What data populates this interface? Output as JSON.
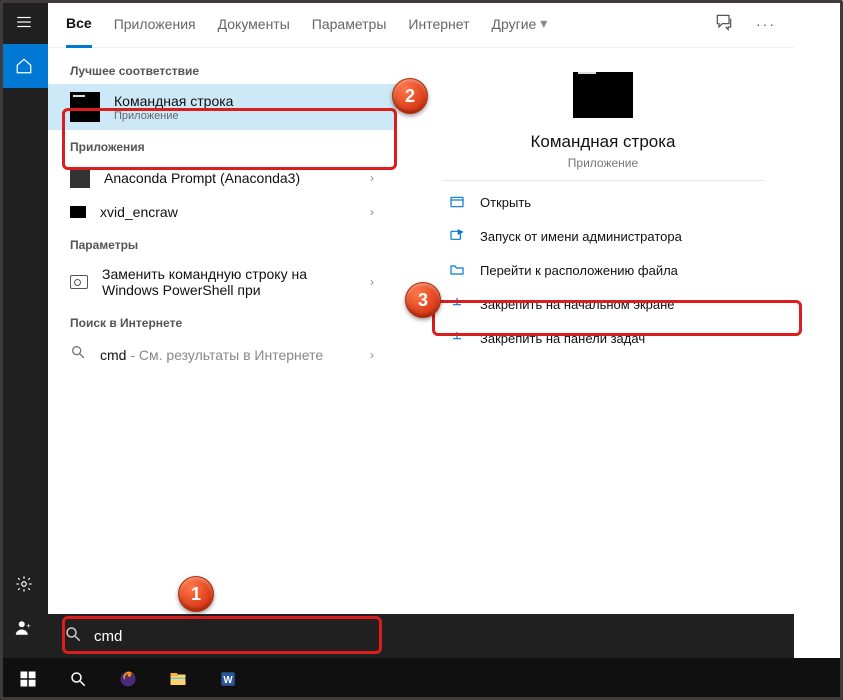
{
  "tabs": {
    "all": "Все",
    "apps": "Приложения",
    "docs": "Документы",
    "settings": "Параметры",
    "web": "Интернет",
    "more": "Другие",
    "more_caret": "▾"
  },
  "sections": {
    "best_match": "Лучшее соответствие",
    "apps": "Приложения",
    "settings": "Параметры",
    "web": "Поиск в Интернете"
  },
  "best": {
    "title": "Командная строка",
    "subtitle": "Приложение"
  },
  "app_results": {
    "r1": "Anaconda Prompt (Anaconda3)",
    "r2": "xvid_encraw"
  },
  "settings_results": {
    "r1_l1": "Заменить командную строку на",
    "r1_l2": "Windows PowerShell при"
  },
  "web_results": {
    "prefix": "cmd",
    "suffix": " - См. результаты в Интернете"
  },
  "preview": {
    "title": "Командная строка",
    "subtitle": "Приложение"
  },
  "actions": {
    "open": "Открыть",
    "admin": "Запуск от имени администратора",
    "location": "Перейти к расположению файла",
    "pin_start": "Закрепить на начальном экране",
    "pin_task": "Закрепить на панели задач"
  },
  "search": {
    "value": "cmd"
  },
  "badges": {
    "b1": "1",
    "b2": "2",
    "b3": "3"
  },
  "chevron": "›",
  "ellipsis": "···"
}
